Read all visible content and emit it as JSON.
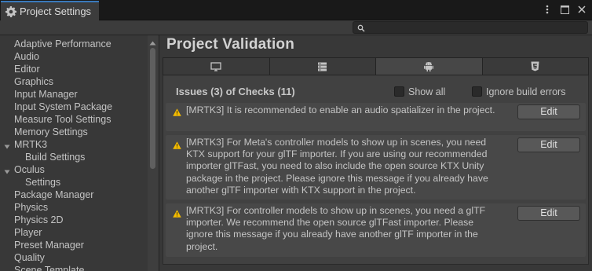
{
  "window": {
    "title": "Project Settings",
    "buttons": [
      "more-icon",
      "maximize-icon",
      "close-icon"
    ]
  },
  "search": {
    "placeholder": ""
  },
  "sidebar": {
    "items": [
      {
        "label": "Adaptive Performance",
        "level": 0
      },
      {
        "label": "Audio",
        "level": 0
      },
      {
        "label": "Editor",
        "level": 0
      },
      {
        "label": "Graphics",
        "level": 0
      },
      {
        "label": "Input Manager",
        "level": 0
      },
      {
        "label": "Input System Package",
        "level": 0
      },
      {
        "label": "Measure Tool Settings",
        "level": 0
      },
      {
        "label": "Memory Settings",
        "level": 0
      },
      {
        "label": "MRTK3",
        "level": 0,
        "expanded": true
      },
      {
        "label": "Build Settings",
        "level": 1
      },
      {
        "label": "Oculus",
        "level": 0,
        "expanded": true
      },
      {
        "label": "Settings",
        "level": 1
      },
      {
        "label": "Package Manager",
        "level": 0
      },
      {
        "label": "Physics",
        "level": 0
      },
      {
        "label": "Physics 2D",
        "level": 0
      },
      {
        "label": "Player",
        "level": 0
      },
      {
        "label": "Preset Manager",
        "level": 0
      },
      {
        "label": "Quality",
        "level": 0
      },
      {
        "label": "Scene Template",
        "level": 0
      }
    ]
  },
  "content": {
    "title": "Project Validation",
    "tabs": [
      {
        "icon": "standalone-monitor-icon",
        "active": false
      },
      {
        "icon": "server-icon",
        "active": false
      },
      {
        "icon": "android-icon",
        "active": true
      },
      {
        "icon": "html5-webgl-icon",
        "active": false
      }
    ],
    "issues_header": "Issues (3) of Checks (11)",
    "show_all_label": "Show all",
    "ignore_build_errors_label": "Ignore build errors",
    "issues": [
      {
        "icon": "warning-icon",
        "message": "[MRTK3] It is recommended to enable an audio spatializer in the project.",
        "button": "Edit"
      },
      {
        "icon": "warning-icon",
        "message": "[MRTK3] For Meta's controller models to show up in scenes, you need KTX support for your glTF importer. If you are using our recommended importer glTFast, you need to also include the open source KTX Unity package in the project. Please ignore this message if you already have another glTF importer with KTX support in the project.",
        "button": "Edit"
      },
      {
        "icon": "warning-icon",
        "message": "[MRTK3] For controller models to show up in scenes, you need a glTF importer. We recommend the open source glTFast importer. Please ignore this message if you already have another glTF importer in the project.",
        "button": "Edit"
      }
    ]
  },
  "colors": {
    "accent": "#3a79bb",
    "warning": "#f4bc02"
  }
}
